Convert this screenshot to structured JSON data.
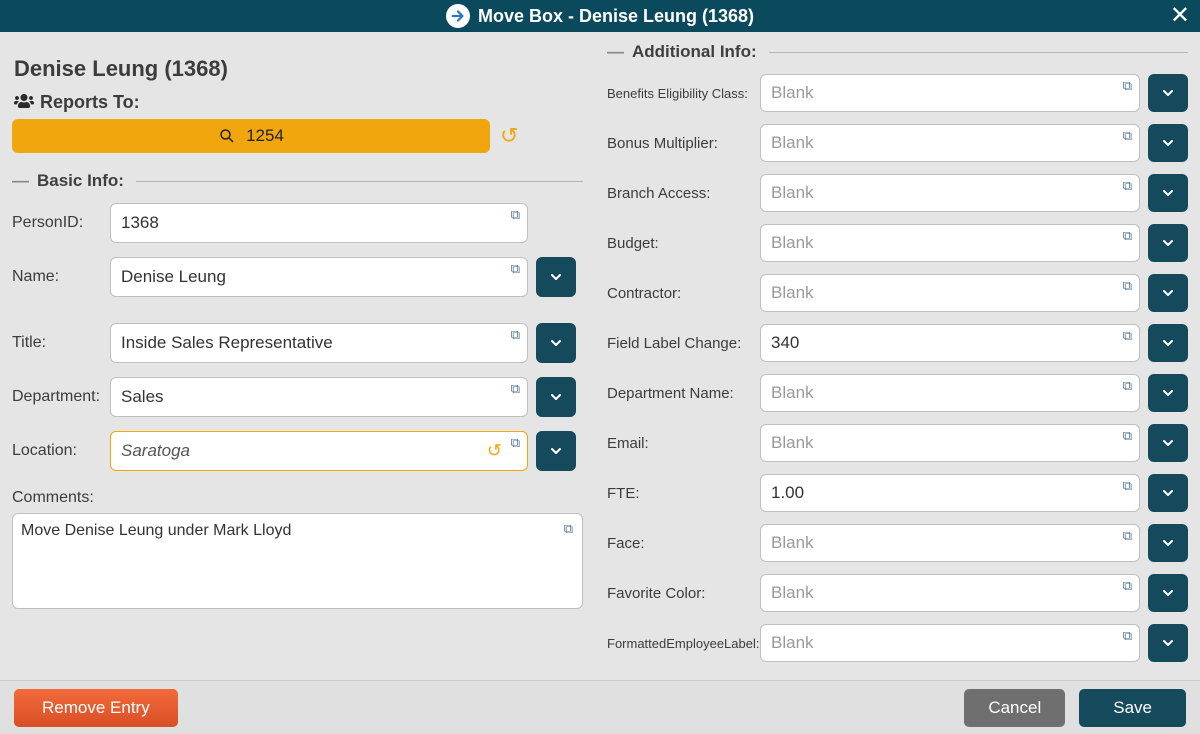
{
  "titlebar": {
    "title": "Move Box - Denise Leung (1368)"
  },
  "heading": "Denise Leung (1368)",
  "reports_to_label": "Reports To:",
  "search_value": "1254",
  "basic_info": {
    "legend": "Basic Info:",
    "fields": {
      "person_id": {
        "label": "PersonID:",
        "value": "1368"
      },
      "name": {
        "label": "Name:",
        "value": "Denise Leung"
      },
      "title": {
        "label": "Title:",
        "value": "Inside Sales Representative"
      },
      "department": {
        "label": "Department:",
        "value": "Sales"
      },
      "location": {
        "label": "Location:",
        "value": "Saratoga"
      }
    }
  },
  "comments": {
    "label": "Comments:",
    "value": "Move Denise Leung under Mark Lloyd"
  },
  "additional_info": {
    "legend": "Additional Info:",
    "fields": [
      {
        "label": "Benefits Eligibility Class:",
        "value": "Blank",
        "blank": true
      },
      {
        "label": "Bonus Multiplier:",
        "value": "Blank",
        "blank": true
      },
      {
        "label": "Branch Access:",
        "value": "Blank",
        "blank": true
      },
      {
        "label": "Budget:",
        "value": "Blank",
        "blank": true
      },
      {
        "label": "Contractor:",
        "value": "Blank",
        "blank": true
      },
      {
        "label": "Field Label Change:",
        "value": "340",
        "blank": false
      },
      {
        "label": "Department Name:",
        "value": "Blank",
        "blank": true
      },
      {
        "label": "Email:",
        "value": "Blank",
        "blank": true
      },
      {
        "label": "FTE:",
        "value": "1.00",
        "blank": false
      },
      {
        "label": "Face:",
        "value": "Blank",
        "blank": true
      },
      {
        "label": "Favorite Color:",
        "value": "Blank",
        "blank": true
      },
      {
        "label": "FormattedEmployeeLabel:",
        "value": "Blank",
        "blank": true
      }
    ]
  },
  "footer": {
    "remove": "Remove Entry",
    "cancel": "Cancel",
    "save": "Save"
  }
}
